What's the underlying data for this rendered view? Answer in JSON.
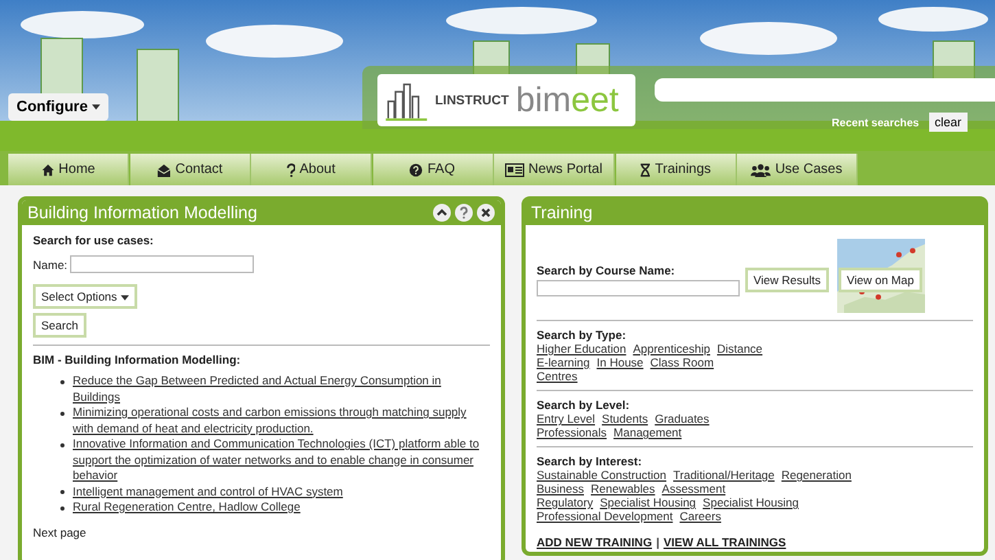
{
  "header": {
    "configure": "Configure",
    "logo": {
      "company": "LINSTRUCT",
      "product": [
        "bim",
        "eet"
      ]
    },
    "recent_label": "Recent searches",
    "clear": "clear"
  },
  "nav": [
    {
      "label": "Home"
    },
    {
      "label": "Contact"
    },
    {
      "label": "About"
    },
    {
      "label": "FAQ"
    },
    {
      "label": "News Portal"
    },
    {
      "label": "Trainings"
    },
    {
      "label": "Use Cases"
    }
  ],
  "bim_panel": {
    "title": "Building Information Modelling",
    "search_heading": "Search for use cases:",
    "name_label": "Name:",
    "select": "Select Options",
    "search_button": "Search",
    "section_heading": "BIM - Building Information Modelling:",
    "items": [
      "Reduce the Gap Between Predicted and Actual Energy Consumption in Buildings",
      "Minimizing operational costs and carbon emissions through matching supply with demand of heat and electricity production.",
      "Innovative Information and Communication Technologies (ICT) platform able to support the optimization of water networks and to enable change in consumer behavior",
      "Intelligent management and control of HVAC system",
      "Rural Regeneration Centre, Hadlow College"
    ],
    "next": "Next page"
  },
  "training_panel": {
    "title": "Training",
    "course_label": "Search by Course Name:",
    "view_results": "View Results",
    "view_map": "View on Map",
    "groups": [
      {
        "heading": "Search by Type:",
        "lines": [
          [
            "Higher Education",
            "Apprenticeship",
            "Distance"
          ],
          [
            "E-learning",
            "In House",
            "Class Room"
          ],
          [
            "Centres"
          ]
        ]
      },
      {
        "heading": "Search by Level:",
        "lines": [
          [
            "Entry Level",
            "Students",
            "Graduates"
          ],
          [
            "Professionals",
            "Management"
          ]
        ]
      },
      {
        "heading": "Search by Interest:",
        "lines": [
          [
            "Sustainable Construction",
            "Traditional/Heritage",
            "Regeneration"
          ],
          [
            "Business",
            "Renewables",
            "Assessment"
          ],
          [
            "Regulatory",
            "Specialist Housing",
            "Specialist Housing"
          ],
          [
            "Professional Development",
            "Careers"
          ]
        ]
      }
    ],
    "footer": [
      "ADD NEW TRAINING",
      "|",
      "VIEW ALL TRAININGS"
    ]
  }
}
